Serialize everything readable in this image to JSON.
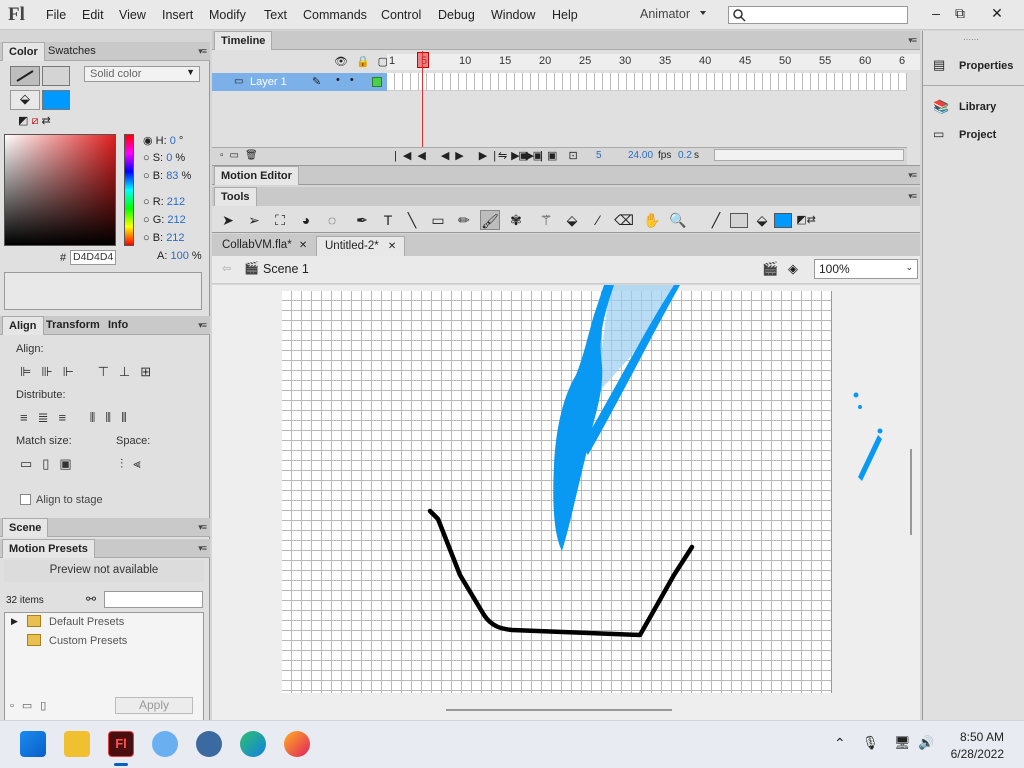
{
  "app": {
    "logo": "Fl",
    "menu": [
      "File",
      "Edit",
      "View",
      "Insert",
      "Modify",
      "Text",
      "Commands",
      "Control",
      "Debug",
      "Window",
      "Help"
    ],
    "workspace": "Animator",
    "window_buttons": [
      "–",
      "⧉",
      "✕"
    ]
  },
  "color_panel": {
    "tabs": [
      "Color",
      "Swatches"
    ],
    "fill_type": "Solid color",
    "stroke_color": "#d4d4d4",
    "fill_color": "#0099ff",
    "hsb": [
      {
        "label": "H:",
        "value": "0",
        "unit": "°"
      },
      {
        "label": "S:",
        "value": "0",
        "unit": "%"
      },
      {
        "label": "B:",
        "value": "83",
        "unit": "%"
      }
    ],
    "rgb": [
      {
        "label": "R:",
        "value": "212"
      },
      {
        "label": "G:",
        "value": "212"
      },
      {
        "label": "B:",
        "value": "212"
      }
    ],
    "alpha_label": "A:",
    "alpha_value": "100",
    "alpha_unit": "%",
    "hex_label": "#",
    "hex_value": "D4D4D4"
  },
  "align_panel": {
    "tabs": [
      "Align",
      "Transform",
      "Info"
    ],
    "align_label": "Align:",
    "distribute_label": "Distribute:",
    "match_label": "Match size:",
    "space_label": "Space:",
    "align_to_stage": "Align to stage"
  },
  "scene_panel": {
    "title": "Scene"
  },
  "motion_presets": {
    "title": "Motion Presets",
    "preview": "Preview not available",
    "count": "32 items",
    "folders": [
      "Default Presets",
      "Custom Presets"
    ],
    "apply": "Apply"
  },
  "timeline": {
    "title": "Timeline",
    "layer_name": "Layer 1",
    "frame_numbers": [
      "1",
      "5",
      "10",
      "15",
      "20",
      "25",
      "30",
      "35",
      "40",
      "45",
      "50",
      "55",
      "60",
      "6"
    ],
    "current_frame": "5",
    "fps": "24.00",
    "fps_unit": "fps",
    "time": "0.2",
    "time_unit": "s"
  },
  "motion_editor": {
    "title": "Motion Editor"
  },
  "tools": {
    "title": "Tools"
  },
  "documents": {
    "tabs": [
      "CollabVM.fla*",
      "Untitled-2*"
    ],
    "scene": "Scene 1",
    "zoom": "100%"
  },
  "right_panel": {
    "items": [
      "Properties",
      "Library",
      "Project"
    ]
  },
  "taskbar": {
    "time": "8:50 AM",
    "date": "6/28/2022"
  },
  "colors": {
    "accent_blue": "#0099ff",
    "layer_highlight": "#7bb0e8",
    "value_blue": "#2a6cc2"
  }
}
